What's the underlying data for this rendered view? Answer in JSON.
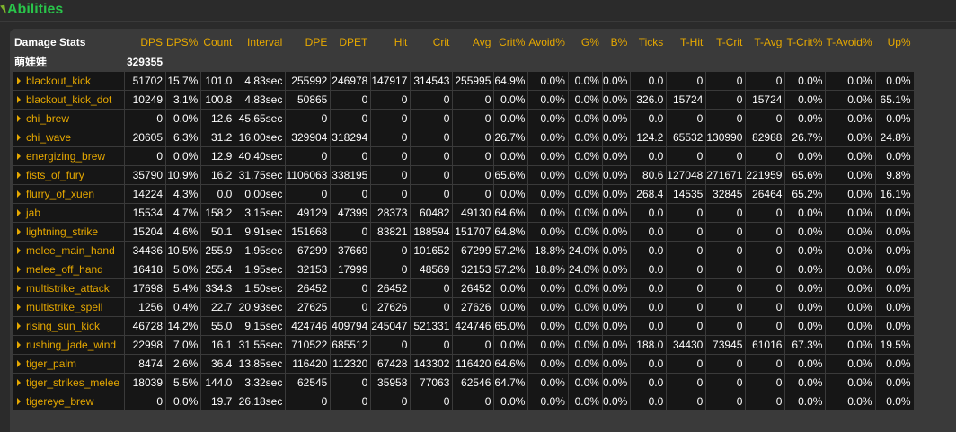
{
  "section": {
    "title": "Abilities"
  },
  "colors": {
    "header": "#e6a800",
    "title": "#29c44a",
    "cell_bg": "#161616",
    "panel_bg": "#3a3a3a"
  },
  "columns": [
    "Damage Stats",
    "DPS",
    "DPS%",
    "Count",
    "Interval",
    "DPE",
    "DPET",
    "Hit",
    "Crit",
    "Avg",
    "Crit%",
    "Avoid%",
    "G%",
    "B%",
    "Ticks",
    "T-Hit",
    "T-Crit",
    "T-Avg",
    "T-Crit%",
    "T-Avoid%",
    "Up%"
  ],
  "player": {
    "name": "萌娃娃",
    "dps": "329355"
  },
  "rows": [
    [
      "blackout_kick",
      "51702",
      "15.7%",
      "101.0",
      "4.83sec",
      "255992",
      "246978",
      "147917",
      "314543",
      "255995",
      "64.9%",
      "0.0%",
      "0.0%",
      "0.0%",
      "0.0",
      "0",
      "0",
      "0",
      "0.0%",
      "0.0%",
      "0.0%"
    ],
    [
      "blackout_kick_dot",
      "10249",
      "3.1%",
      "100.8",
      "4.83sec",
      "50865",
      "0",
      "0",
      "0",
      "0",
      "0.0%",
      "0.0%",
      "0.0%",
      "0.0%",
      "326.0",
      "15724",
      "0",
      "15724",
      "0.0%",
      "0.0%",
      "65.1%"
    ],
    [
      "chi_brew",
      "0",
      "0.0%",
      "12.6",
      "45.65sec",
      "0",
      "0",
      "0",
      "0",
      "0",
      "0.0%",
      "0.0%",
      "0.0%",
      "0.0%",
      "0.0",
      "0",
      "0",
      "0",
      "0.0%",
      "0.0%",
      "0.0%"
    ],
    [
      "chi_wave",
      "20605",
      "6.3%",
      "31.2",
      "16.00sec",
      "329904",
      "318294",
      "0",
      "0",
      "0",
      "26.7%",
      "0.0%",
      "0.0%",
      "0.0%",
      "124.2",
      "65532",
      "130990",
      "82988",
      "26.7%",
      "0.0%",
      "24.8%"
    ],
    [
      "energizing_brew",
      "0",
      "0.0%",
      "12.9",
      "40.40sec",
      "0",
      "0",
      "0",
      "0",
      "0",
      "0.0%",
      "0.0%",
      "0.0%",
      "0.0%",
      "0.0",
      "0",
      "0",
      "0",
      "0.0%",
      "0.0%",
      "0.0%"
    ],
    [
      "fists_of_fury",
      "35790",
      "10.9%",
      "16.2",
      "31.75sec",
      "1106063",
      "338195",
      "0",
      "0",
      "0",
      "65.6%",
      "0.0%",
      "0.0%",
      "0.0%",
      "80.6",
      "127048",
      "271671",
      "221959",
      "65.6%",
      "0.0%",
      "9.8%"
    ],
    [
      "flurry_of_xuen",
      "14224",
      "4.3%",
      "0.0",
      "0.00sec",
      "0",
      "0",
      "0",
      "0",
      "0",
      "0.0%",
      "0.0%",
      "0.0%",
      "0.0%",
      "268.4",
      "14535",
      "32845",
      "26464",
      "65.2%",
      "0.0%",
      "16.1%"
    ],
    [
      "jab",
      "15534",
      "4.7%",
      "158.2",
      "3.15sec",
      "49129",
      "47399",
      "28373",
      "60482",
      "49130",
      "64.6%",
      "0.0%",
      "0.0%",
      "0.0%",
      "0.0",
      "0",
      "0",
      "0",
      "0.0%",
      "0.0%",
      "0.0%"
    ],
    [
      "lightning_strike",
      "15204",
      "4.6%",
      "50.1",
      "9.91sec",
      "151668",
      "0",
      "83821",
      "188594",
      "151707",
      "64.8%",
      "0.0%",
      "0.0%",
      "0.0%",
      "0.0",
      "0",
      "0",
      "0",
      "0.0%",
      "0.0%",
      "0.0%"
    ],
    [
      "melee_main_hand",
      "34436",
      "10.5%",
      "255.9",
      "1.95sec",
      "67299",
      "37669",
      "0",
      "101652",
      "67299",
      "57.2%",
      "18.8%",
      "24.0%",
      "0.0%",
      "0.0",
      "0",
      "0",
      "0",
      "0.0%",
      "0.0%",
      "0.0%"
    ],
    [
      "melee_off_hand",
      "16418",
      "5.0%",
      "255.4",
      "1.95sec",
      "32153",
      "17999",
      "0",
      "48569",
      "32153",
      "57.2%",
      "18.8%",
      "24.0%",
      "0.0%",
      "0.0",
      "0",
      "0",
      "0",
      "0.0%",
      "0.0%",
      "0.0%"
    ],
    [
      "multistrike_attack",
      "17698",
      "5.4%",
      "334.3",
      "1.50sec",
      "26452",
      "0",
      "26452",
      "0",
      "26452",
      "0.0%",
      "0.0%",
      "0.0%",
      "0.0%",
      "0.0",
      "0",
      "0",
      "0",
      "0.0%",
      "0.0%",
      "0.0%"
    ],
    [
      "multistrike_spell",
      "1256",
      "0.4%",
      "22.7",
      "20.93sec",
      "27625",
      "0",
      "27626",
      "0",
      "27626",
      "0.0%",
      "0.0%",
      "0.0%",
      "0.0%",
      "0.0",
      "0",
      "0",
      "0",
      "0.0%",
      "0.0%",
      "0.0%"
    ],
    [
      "rising_sun_kick",
      "46728",
      "14.2%",
      "55.0",
      "9.15sec",
      "424746",
      "409794",
      "245047",
      "521331",
      "424746",
      "65.0%",
      "0.0%",
      "0.0%",
      "0.0%",
      "0.0",
      "0",
      "0",
      "0",
      "0.0%",
      "0.0%",
      "0.0%"
    ],
    [
      "rushing_jade_wind",
      "22998",
      "7.0%",
      "16.1",
      "31.55sec",
      "710522",
      "685512",
      "0",
      "0",
      "0",
      "0.0%",
      "0.0%",
      "0.0%",
      "0.0%",
      "188.0",
      "34430",
      "73945",
      "61016",
      "67.3%",
      "0.0%",
      "19.5%"
    ],
    [
      "tiger_palm",
      "8474",
      "2.6%",
      "36.4",
      "13.85sec",
      "116420",
      "112320",
      "67428",
      "143302",
      "116420",
      "64.6%",
      "0.0%",
      "0.0%",
      "0.0%",
      "0.0",
      "0",
      "0",
      "0",
      "0.0%",
      "0.0%",
      "0.0%"
    ],
    [
      "tiger_strikes_melee",
      "18039",
      "5.5%",
      "144.0",
      "3.32sec",
      "62545",
      "0",
      "35958",
      "77063",
      "62546",
      "64.7%",
      "0.0%",
      "0.0%",
      "0.0%",
      "0.0",
      "0",
      "0",
      "0",
      "0.0%",
      "0.0%",
      "0.0%"
    ],
    [
      "tigereye_brew",
      "0",
      "0.0%",
      "19.7",
      "26.18sec",
      "0",
      "0",
      "0",
      "0",
      "0",
      "0.0%",
      "0.0%",
      "0.0%",
      "0.0%",
      "0.0",
      "0",
      "0",
      "0",
      "0.0%",
      "0.0%",
      "0.0%"
    ]
  ]
}
